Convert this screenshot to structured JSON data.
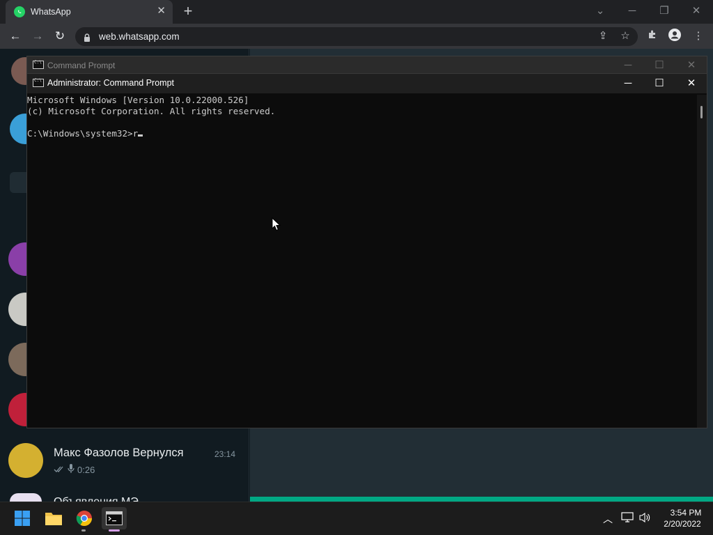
{
  "browser": {
    "tab_title": "WhatsApp",
    "url": "web.whatsapp.com",
    "tab_close": "✕",
    "new_tab": "+"
  },
  "whatsapp": {
    "chat_name": "Макс Фазолов Вернулся",
    "chat_time": "23:14",
    "chat_preview_duration": "0:26",
    "next_chat_partial": "Объявления МЭ"
  },
  "cmd_background": {
    "title": "Command Prompt"
  },
  "cmd": {
    "title": "Administrator: Command Prompt",
    "lines": [
      "Microsoft Windows [Version 10.0.22000.526]",
      "(c) Microsoft Corporation. All rights reserved.",
      "",
      "C:\\Windows\\system32>r"
    ]
  },
  "taskbar": {
    "time": "3:54 PM",
    "date": "2/20/2022"
  },
  "colors": {
    "whatsapp_green": "#00a884",
    "console_text": "#cccccc",
    "console_bg": "#0c0c0c"
  }
}
